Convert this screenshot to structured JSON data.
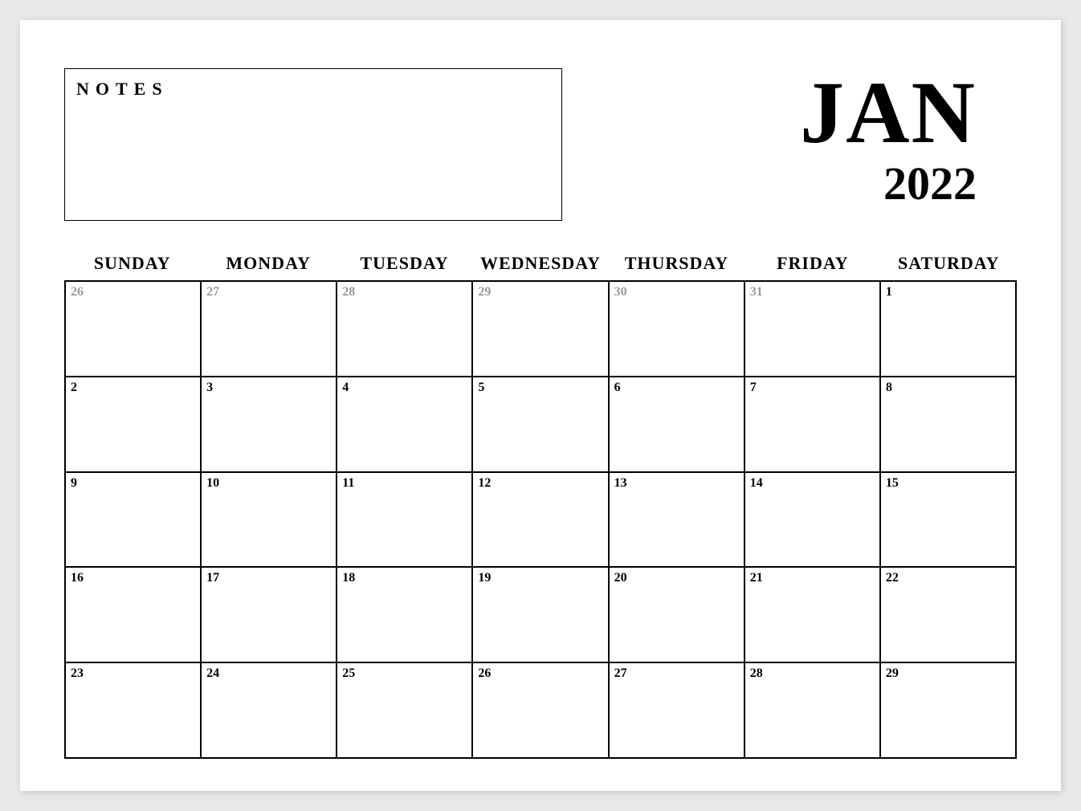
{
  "notes_label": "NOTES",
  "month": "JAN",
  "year": "2022",
  "weekdays": [
    "SUNDAY",
    "MONDAY",
    "TUESDAY",
    "WEDNESDAY",
    "THURSDAY",
    "FRIDAY",
    "SATURDAY"
  ],
  "days": [
    {
      "n": "26",
      "muted": true
    },
    {
      "n": "27",
      "muted": true
    },
    {
      "n": "28",
      "muted": true
    },
    {
      "n": "29",
      "muted": true
    },
    {
      "n": "30",
      "muted": true
    },
    {
      "n": "31",
      "muted": true
    },
    {
      "n": "1",
      "muted": false
    },
    {
      "n": "2",
      "muted": false
    },
    {
      "n": "3",
      "muted": false
    },
    {
      "n": "4",
      "muted": false
    },
    {
      "n": "5",
      "muted": false
    },
    {
      "n": "6",
      "muted": false
    },
    {
      "n": "7",
      "muted": false
    },
    {
      "n": "8",
      "muted": false
    },
    {
      "n": "9",
      "muted": false
    },
    {
      "n": "10",
      "muted": false
    },
    {
      "n": "11",
      "muted": false
    },
    {
      "n": "12",
      "muted": false
    },
    {
      "n": "13",
      "muted": false
    },
    {
      "n": "14",
      "muted": false
    },
    {
      "n": "15",
      "muted": false
    },
    {
      "n": "16",
      "muted": false
    },
    {
      "n": "17",
      "muted": false
    },
    {
      "n": "18",
      "muted": false
    },
    {
      "n": "19",
      "muted": false
    },
    {
      "n": "20",
      "muted": false
    },
    {
      "n": "21",
      "muted": false
    },
    {
      "n": "22",
      "muted": false
    },
    {
      "n": "23",
      "muted": false
    },
    {
      "n": "24",
      "muted": false
    },
    {
      "n": "25",
      "muted": false
    },
    {
      "n": "26",
      "muted": false
    },
    {
      "n": "27",
      "muted": false
    },
    {
      "n": "28",
      "muted": false
    },
    {
      "n": "29",
      "muted": false
    }
  ]
}
